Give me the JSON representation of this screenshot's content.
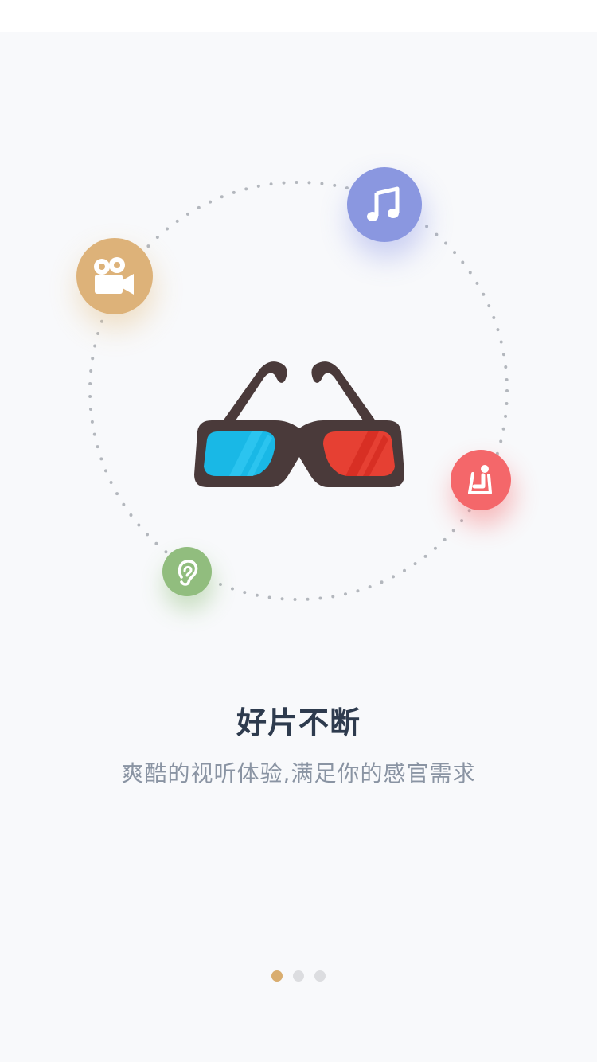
{
  "onboarding": {
    "title": "好片不断",
    "subtitle": "爽酷的视听体验,满足你的感官需求"
  },
  "pager": {
    "page_count": 3,
    "active_index": 0
  },
  "icons": {
    "center": "3d-glasses-icon",
    "features": [
      "movie-camera-icon",
      "music-note-icon",
      "cinema-seat-icon",
      "ear-icon"
    ]
  },
  "colors": {
    "background": "#f8f9fb",
    "camera": "#ddb279",
    "music": "#8a97e0",
    "seat": "#f4676a",
    "ear": "#91bd7e",
    "frame": "#4a3a3a",
    "lens_left": "#1fbde9",
    "lens_right": "#e64033",
    "dot_active": "#d9ad6f",
    "dot_inactive": "#dcdde0"
  }
}
